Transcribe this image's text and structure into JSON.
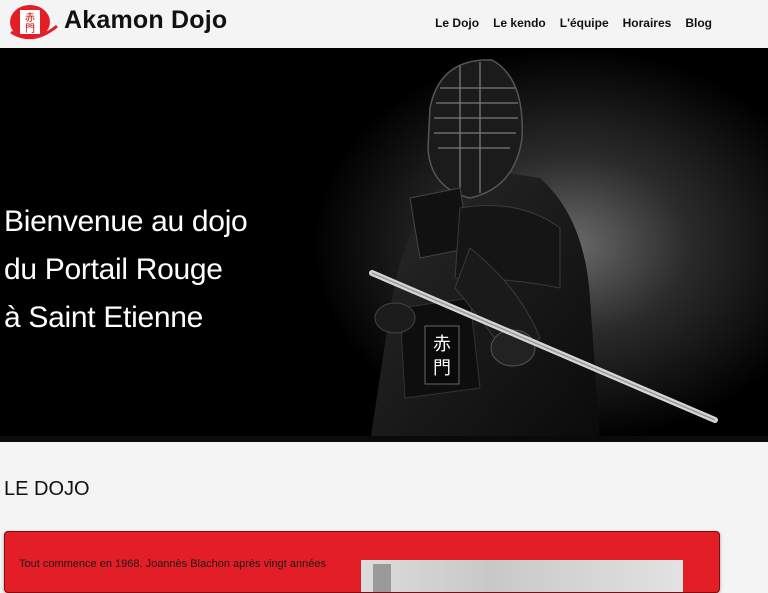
{
  "header": {
    "title": "Akamon Dojo",
    "logo_glyph": "赤門",
    "logo_color": "#e41e26",
    "nav": [
      {
        "label": "Le Dojo"
      },
      {
        "label": "Le kendo"
      },
      {
        "label": "L'équipe"
      },
      {
        "label": "Horaires"
      },
      {
        "label": "Blog"
      }
    ]
  },
  "hero": {
    "lines": [
      "Bienvenue au dojo",
      "du Portail Rouge",
      "à Saint Etienne"
    ],
    "armor_kanji": "赤門"
  },
  "section": {
    "heading": "LE DOJO",
    "intro": "Tout commence en 1968. Joannès Blachon après vingt années",
    "card_color": "#e41e26"
  }
}
